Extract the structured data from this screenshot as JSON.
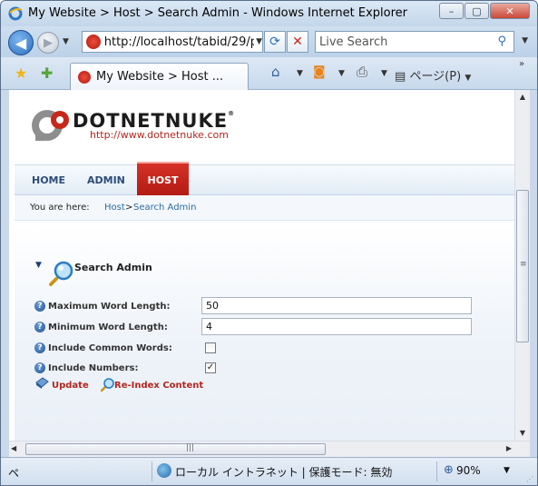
{
  "window": {
    "title": "My Website > Host > Search Admin - Windows Internet Explorer",
    "min_label": "–",
    "max_label": "▢",
    "close_label": "✕"
  },
  "address_bar": {
    "url": "http://localhost/tabid/29/p"
  },
  "search_bar": {
    "placeholder": "Live Search"
  },
  "tab": {
    "label": "My Website > Host ..."
  },
  "toolbar": {
    "page_label": "ページ(P)"
  },
  "status_bar": {
    "left_text": "ペ",
    "zone_text": "ローカル イントラネット | 保護モード: 無効",
    "zoom": "90%"
  },
  "logo": {
    "text": "DOTNETNUKE",
    "tm": "®",
    "url": "http://www.dotnetnuke.com"
  },
  "menu": {
    "items": [
      {
        "label": "HOME"
      },
      {
        "label": "ADMIN"
      },
      {
        "label": "HOST",
        "active": true
      }
    ]
  },
  "breadcrumb": {
    "prefix": "You are here:",
    "links": [
      "Host",
      "Search Admin"
    ],
    "separator": ">"
  },
  "module": {
    "title": "Search Admin",
    "fields": {
      "max_word_length": {
        "label": "Maximum Word Length:",
        "value": "50"
      },
      "min_word_length": {
        "label": "Minimum Word Length:",
        "value": "4"
      },
      "include_common_words": {
        "label": "Include Common Words:",
        "checked": false
      },
      "include_numbers": {
        "label": "Include Numbers:",
        "checked": true
      }
    },
    "commands": {
      "update": "Update",
      "reindex": "Re-Index Content"
    }
  },
  "colors": {
    "brand_red": "#b3271f",
    "link_blue": "#2e6a9b",
    "menu_blue": "#2e4d78"
  }
}
